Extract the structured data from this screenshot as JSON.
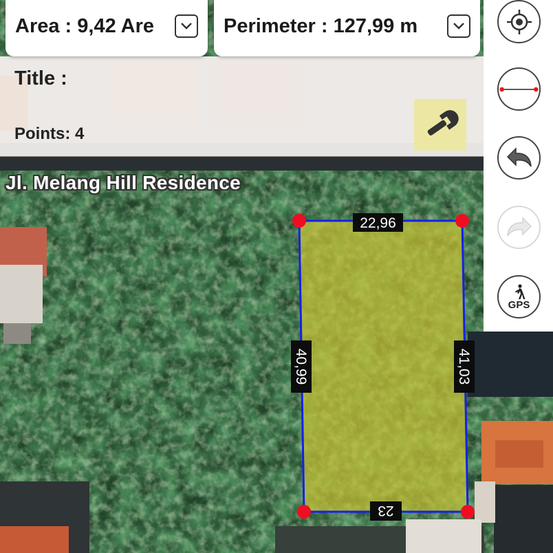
{
  "header": {
    "area_text": "Area : 9,42 Are",
    "perimeter_text": "Perimeter : 127,99 m"
  },
  "info": {
    "title_label": "Title :",
    "points_label": "Points: 4"
  },
  "map": {
    "street_label": "Jl. Melang Hill Residence",
    "polygon_fill": "#c8c235",
    "polygon_stroke": "#1521e8",
    "vertex_color": "#ee0e22",
    "edges": [
      {
        "id": "top",
        "label": "22,96"
      },
      {
        "id": "right",
        "label": "41,03"
      },
      {
        "id": "bottom",
        "label": "23"
      },
      {
        "id": "left",
        "label": "40,99"
      }
    ]
  },
  "toolbar": {
    "buttons": [
      {
        "id": "locate",
        "icon": "crosshair-icon"
      },
      {
        "id": "measure-line",
        "icon": "line-measure-icon"
      },
      {
        "id": "undo",
        "icon": "undo-icon"
      },
      {
        "id": "redo",
        "icon": "redo-icon"
      },
      {
        "id": "gps",
        "icon": "walking-person-icon",
        "label": "GPS"
      }
    ],
    "tools_icon": "wrench-icon"
  }
}
